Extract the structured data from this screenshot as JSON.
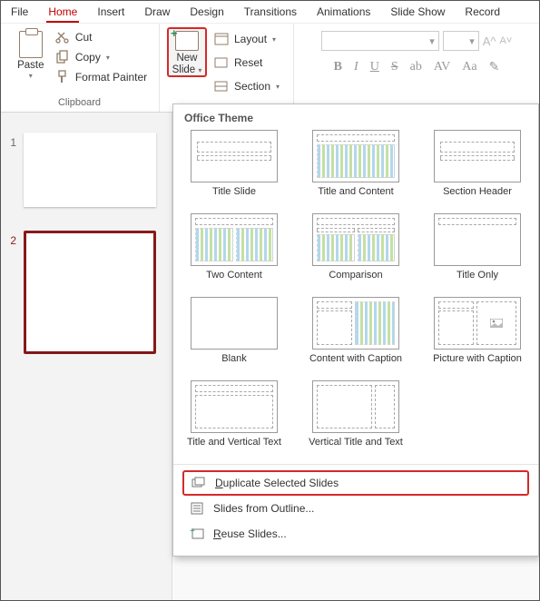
{
  "tabs": [
    "File",
    "Home",
    "Insert",
    "Draw",
    "Design",
    "Transitions",
    "Animations",
    "Slide Show",
    "Record"
  ],
  "active_tab": "Home",
  "clipboard": {
    "paste_label": "Paste",
    "cut_label": "Cut",
    "copy_label": "Copy",
    "format_painter_label": "Format Painter",
    "group_label": "Clipboard"
  },
  "slides": {
    "new_slide_label": "New Slide",
    "layout_label": "Layout",
    "reset_label": "Reset",
    "section_label": "Section"
  },
  "thumbnails": [
    {
      "num": "1",
      "selected": false
    },
    {
      "num": "2",
      "selected": true
    }
  ],
  "popup": {
    "title": "Office Theme",
    "layouts": [
      "Title Slide",
      "Title and Content",
      "Section Header",
      "Two Content",
      "Comparison",
      "Title Only",
      "Blank",
      "Content with Caption",
      "Picture with Caption",
      "Title and Vertical Text",
      "Vertical Title and Text"
    ],
    "menu": {
      "duplicate": "Duplicate Selected Slides",
      "from_outline": "Slides from Outline...",
      "reuse": "Reuse Slides..."
    }
  }
}
